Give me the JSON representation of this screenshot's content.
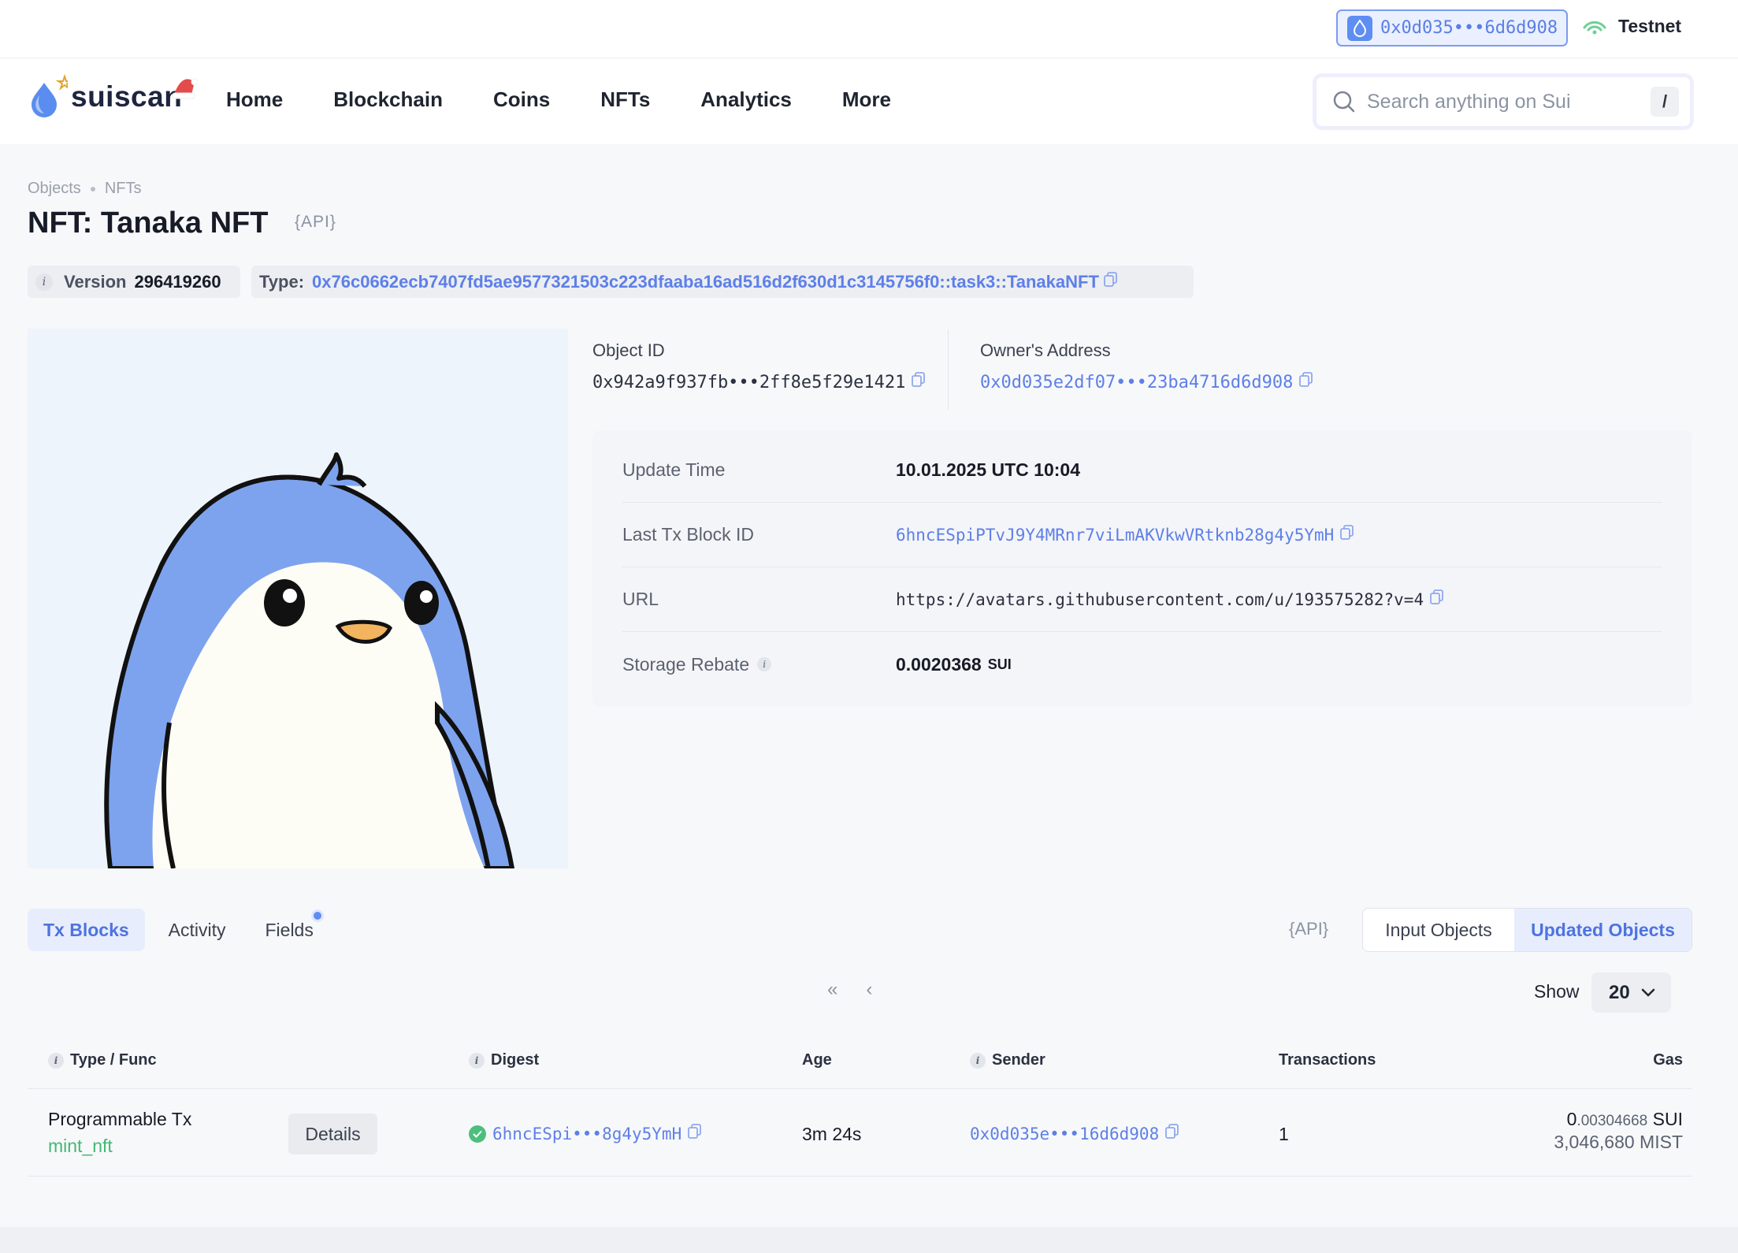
{
  "topbar": {
    "wallet_address": "0x0d035•••6d6d908",
    "network": "Testnet"
  },
  "nav": {
    "logo_text": "suiscan",
    "links": [
      "Home",
      "Blockchain",
      "Coins",
      "NFTs",
      "Analytics",
      "More"
    ],
    "search_placeholder": "Search anything on Sui",
    "search_shortcut": "/"
  },
  "breadcrumb": [
    "Objects",
    "NFTs"
  ],
  "page": {
    "title": "NFT: Tanaka NFT",
    "api_label": "{API}",
    "version_label": "Version",
    "version_value": "296419260",
    "type_label": "Type:",
    "type_value": "0x76c0662ecb7407fd5ae9577321503c223dfaaba16ad516d2f630d1c3145756f0::task3::TanakaNFT"
  },
  "object": {
    "object_id_label": "Object ID",
    "object_id": "0x942a9f937fb•••2ff8e5f29e1421",
    "owner_label": "Owner's Address",
    "owner": "0x0d035e2df07•••23ba4716d6d908"
  },
  "details": {
    "update_time_label": "Update Time",
    "update_time": "10.01.2025 UTC 10:04",
    "last_tx_label": "Last Tx Block ID",
    "last_tx": "6hncESpiPTvJ9Y4MRnr7viLmAKVkwVRtknb28g4y5YmH",
    "url_label": "URL",
    "url": "https://avatars.githubusercontent.com/u/193575282?v=4",
    "storage_rebate_label": "Storage Rebate",
    "storage_rebate": "0.0020368",
    "storage_rebate_unit": "SUI"
  },
  "tabs": [
    "Tx Blocks",
    "Activity",
    "Fields"
  ],
  "tabs_api_label": "{API}",
  "segment": [
    "Input Objects",
    "Updated Objects"
  ],
  "pager": {
    "first": "«",
    "prev": "‹",
    "show_label": "Show",
    "page_size": "20"
  },
  "table": {
    "columns": [
      "Type / Func",
      "Digest",
      "Age",
      "Sender",
      "Transactions",
      "Gas"
    ],
    "rows": [
      {
        "type": "Programmable Tx",
        "func": "mint_nft",
        "details_label": "Details",
        "digest": "6hncESpi•••8g4y5YmH",
        "age": "3m 24s",
        "sender": "0x0d035e•••16d6d908",
        "transactions": "1",
        "gas_int": "0",
        "gas_frac": ".00304668",
        "gas_unit": "SUI",
        "gas_mist": "3,046,680 MIST"
      }
    ]
  },
  "colors": {
    "accent": "#5d7fe8",
    "nft_bg": "#eef4fb",
    "penguin_blue": "#7ea3ee",
    "success": "#4dbf7d",
    "func_green": "#43b873"
  }
}
